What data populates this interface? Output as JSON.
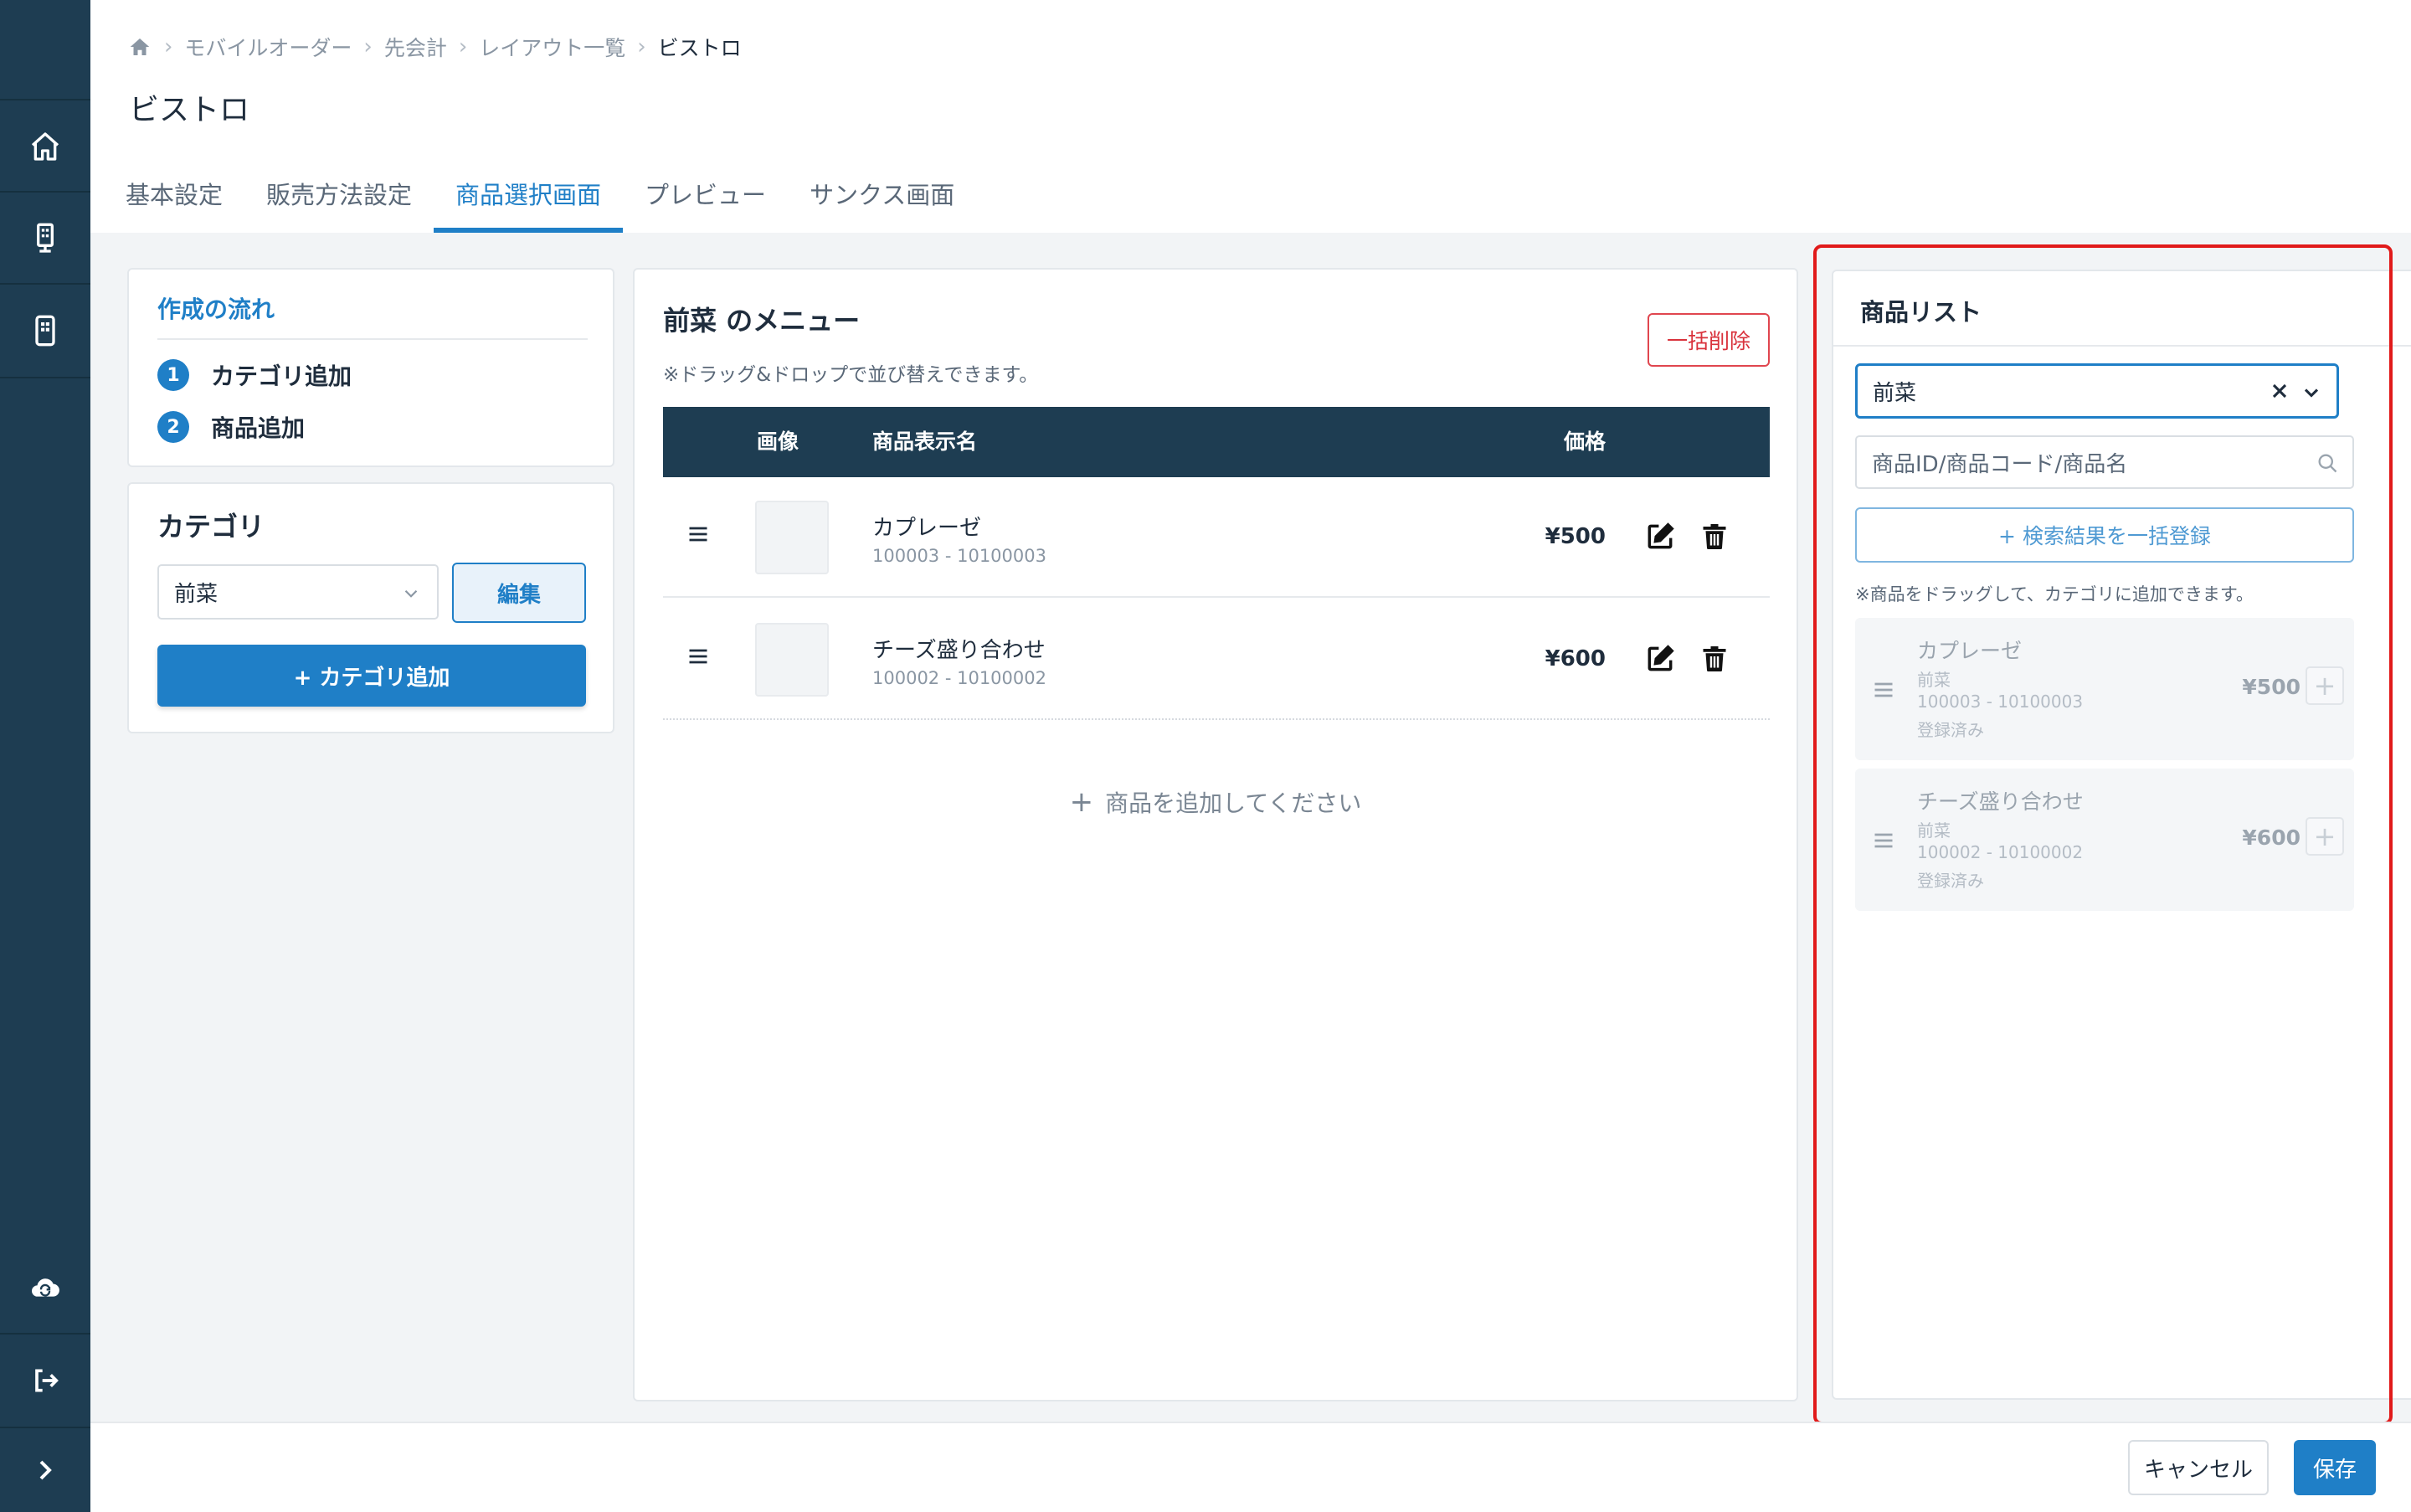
{
  "breadcrumb": {
    "items": [
      "モバイルオーダー",
      "先会計",
      "レイアウト一覧"
    ],
    "current": "ビストロ"
  },
  "page": {
    "title": "ビストロ"
  },
  "tabs": [
    {
      "label": "基本設定"
    },
    {
      "label": "販売方法設定"
    },
    {
      "label": "商品選択画面",
      "active": true
    },
    {
      "label": "プレビュー"
    },
    {
      "label": "サンクス画面"
    }
  ],
  "flow": {
    "title": "作成の流れ",
    "steps": [
      {
        "num": "1",
        "label": "カテゴリ追加"
      },
      {
        "num": "2",
        "label": "商品追加"
      }
    ]
  },
  "category": {
    "title": "カテゴリ",
    "selected": "前菜",
    "edit_label": "編集",
    "add_label": "+ カテゴリ追加"
  },
  "menu": {
    "title": "前菜 のメニュー",
    "note": "※ドラッグ&ドロップで並び替えできます。",
    "bulk_delete_label": "一括削除",
    "columns": {
      "image": "画像",
      "name": "商品表示名",
      "price": "価格"
    },
    "rows": [
      {
        "name": "カプレーゼ",
        "code": "100003 - 10100003",
        "price": "¥500"
      },
      {
        "name": "チーズ盛り合わせ",
        "code": "100002 - 10100002",
        "price": "¥600"
      }
    ],
    "add_product_label": "商品を追加してください"
  },
  "product_list": {
    "title": "商品リスト",
    "selected_category": "前菜",
    "search_placeholder": "商品ID/商品コード/商品名",
    "bulk_register_label": "+ 検索結果を一括登録",
    "note": "※商品をドラッグして、カテゴリに追加できます。",
    "items": [
      {
        "name": "カプレーゼ",
        "category": "前菜",
        "code": "100003 - 10100003",
        "status": "登録済み",
        "price": "¥500"
      },
      {
        "name": "チーズ盛り合わせ",
        "category": "前菜",
        "code": "100002 - 10100002",
        "status": "登録済み",
        "price": "¥600"
      }
    ]
  },
  "footer": {
    "cancel_label": "キャンセル",
    "save_label": "保存"
  },
  "colors": {
    "accent": "#1f7fc7",
    "rail": "#1e3d52",
    "danger": "#e0464f",
    "highlight": "#e11a1a"
  },
  "icons": [
    "home-icon",
    "kiosk-icon",
    "tablet-icon",
    "cloud-sync-icon",
    "logout-icon",
    "chevron-right-icon",
    "edit-icon",
    "trash-icon",
    "drag-handle-icon",
    "search-icon",
    "clear-icon",
    "chevron-down-icon"
  ]
}
